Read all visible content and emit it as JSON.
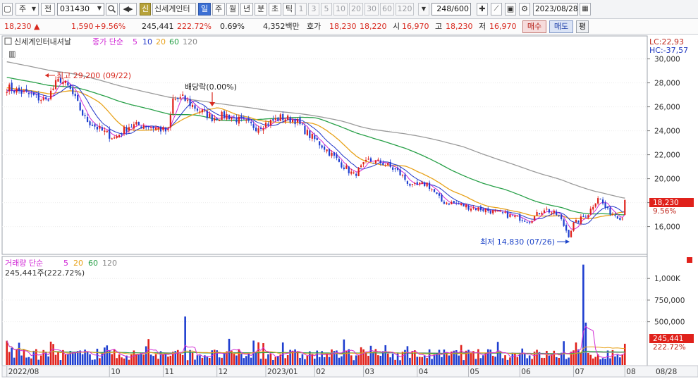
{
  "toolbar": {
    "period_type": "주",
    "market": "전",
    "code": "031430",
    "search_icon": "magnifier-icon",
    "stock_badge": "신",
    "stock_name": "신세계인터",
    "tabs": [
      "일",
      "주",
      "월",
      "년",
      "분",
      "초",
      "틱"
    ],
    "active_tab": "일",
    "intervals": [
      "1",
      "3",
      "5",
      "10",
      "20",
      "30",
      "60",
      "120"
    ],
    "count": "248",
    "count_total": "/600",
    "date": "2023/08/28"
  },
  "quote": {
    "price": "18,230",
    "change": "1,590",
    "change_pct": "+9.56%",
    "volume": "245,441",
    "volume_ratio": "222.72%",
    "turnover": "0.69%",
    "amount": "4,352백만",
    "hoga_label": "호가",
    "ask": "18,230",
    "bid": "18,220",
    "open_label": "시",
    "open": "16,970",
    "high_label": "고",
    "high": "18,230",
    "low_label": "저",
    "low": "16,970",
    "buy": "매수",
    "sell": "매도",
    "eval": "평"
  },
  "colors": {
    "up": "#e0211b",
    "down": "#1f3fd0",
    "ma5": "#d12bd6",
    "ma10": "#2438c9",
    "ma20": "#e8a21a",
    "ma60": "#28a048",
    "ma120": "#9a9a9a"
  },
  "price_panel": {
    "title": "신세계인터내셔날",
    "legend_prefix": "종가 단순",
    "ma_labels": [
      "5",
      "10",
      "20",
      "60",
      "120"
    ],
    "lc": "LC:22,93",
    "hc": "HC:-37,57",
    "y_ticks": [
      16000,
      18000,
      20000,
      22000,
      24000,
      26000,
      28000,
      30000
    ],
    "y_tick_labels": [
      "16,000",
      "18,000",
      "20,000",
      "22,000",
      "24,000",
      "26,000",
      "28,000",
      "30,000"
    ],
    "y_range": [
      13800,
      31800
    ],
    "last_price_tag": "18,230",
    "last_pct_tag": "9.56%",
    "high_annotation": "최고 29,200 (09/22)",
    "low_annotation": "최저 14,830 (07/26)",
    "dividend_annotation": "배당락(0.00%)"
  },
  "volume_panel": {
    "legend_prefix": "거래량 단순",
    "ma_labels": [
      "5",
      "20",
      "60",
      "120"
    ],
    "current": "245,441주(222.72%)",
    "y_ticks": [
      500000,
      750000,
      1000000
    ],
    "y_tick_labels": [
      "500,000",
      "750,000",
      "1,000K"
    ],
    "y_range": [
      0,
      1230000
    ],
    "last_vol_tag": "245,441",
    "last_pct_tag": "222.72%"
  },
  "x_axis": {
    "labels": [
      "2022/08",
      "10",
      "11",
      "12",
      "2023/01",
      "02",
      "03",
      "04",
      "05",
      "06",
      "07",
      "08"
    ],
    "label_days": [
      0,
      42,
      64,
      86,
      106,
      126,
      146,
      168,
      189,
      210,
      232,
      253
    ],
    "right_label": "08/28"
  },
  "chart_data": {
    "type": "candlestick",
    "title": "신세계인터내셔날",
    "x_start": "2022/08/22",
    "x_end": "2023/08/28",
    "ylim": [
      13800,
      31800
    ],
    "close_anchors": [
      {
        "day": 0,
        "close": 27600
      },
      {
        "day": 8,
        "close": 27100
      },
      {
        "day": 16,
        "close": 26500
      },
      {
        "day": 20,
        "close": 27900
      },
      {
        "day": 22,
        "close": 28300
      },
      {
        "day": 26,
        "close": 27400
      },
      {
        "day": 32,
        "close": 25000
      },
      {
        "day": 38,
        "close": 24100
      },
      {
        "day": 44,
        "close": 23400
      },
      {
        "day": 50,
        "close": 24400
      },
      {
        "day": 56,
        "close": 24500
      },
      {
        "day": 62,
        "close": 24200
      },
      {
        "day": 66,
        "close": 23900
      },
      {
        "day": 68,
        "close": 26600
      },
      {
        "day": 72,
        "close": 26700
      },
      {
        "day": 78,
        "close": 25800
      },
      {
        "day": 84,
        "close": 25100
      },
      {
        "day": 90,
        "close": 25300
      },
      {
        "day": 96,
        "close": 24800
      },
      {
        "day": 102,
        "close": 24300
      },
      {
        "day": 106,
        "close": 24600
      },
      {
        "day": 112,
        "close": 25100
      },
      {
        "day": 118,
        "close": 24900
      },
      {
        "day": 124,
        "close": 23600
      },
      {
        "day": 130,
        "close": 22600
      },
      {
        "day": 136,
        "close": 21400
      },
      {
        "day": 142,
        "close": 20300
      },
      {
        "day": 148,
        "close": 21500
      },
      {
        "day": 154,
        "close": 21300
      },
      {
        "day": 160,
        "close": 20600
      },
      {
        "day": 166,
        "close": 19300
      },
      {
        "day": 172,
        "close": 19600
      },
      {
        "day": 178,
        "close": 18100
      },
      {
        "day": 184,
        "close": 17900
      },
      {
        "day": 190,
        "close": 17600
      },
      {
        "day": 196,
        "close": 17400
      },
      {
        "day": 202,
        "close": 17100
      },
      {
        "day": 208,
        "close": 16800
      },
      {
        "day": 214,
        "close": 16500
      },
      {
        "day": 220,
        "close": 17500
      },
      {
        "day": 226,
        "close": 16900
      },
      {
        "day": 230,
        "close": 15300
      },
      {
        "day": 232,
        "close": 16200
      },
      {
        "day": 238,
        "close": 17100
      },
      {
        "day": 242,
        "close": 18500
      },
      {
        "day": 246,
        "close": 17300
      },
      {
        "day": 252,
        "close": 16700
      },
      {
        "day": 253,
        "close": 18230
      }
    ],
    "last_bar": {
      "date": "2023/08/28",
      "open": 16970,
      "high": 18230,
      "low": 16970,
      "close": 18230,
      "volume": 245441
    },
    "period_high": {
      "date": "09/22",
      "price": 29200
    },
    "period_low": {
      "date": "07/26",
      "price": 14830
    },
    "volume_spikes": [
      {
        "day": 73,
        "volume": 560000
      },
      {
        "day": 58,
        "volume": 300000
      },
      {
        "day": 113,
        "volume": 260000
      },
      {
        "day": 236,
        "volume": 1160000
      },
      {
        "day": 237,
        "volume": 490000
      },
      {
        "day": 233,
        "volume": 260000
      },
      {
        "day": 253,
        "volume": 245441
      }
    ]
  }
}
